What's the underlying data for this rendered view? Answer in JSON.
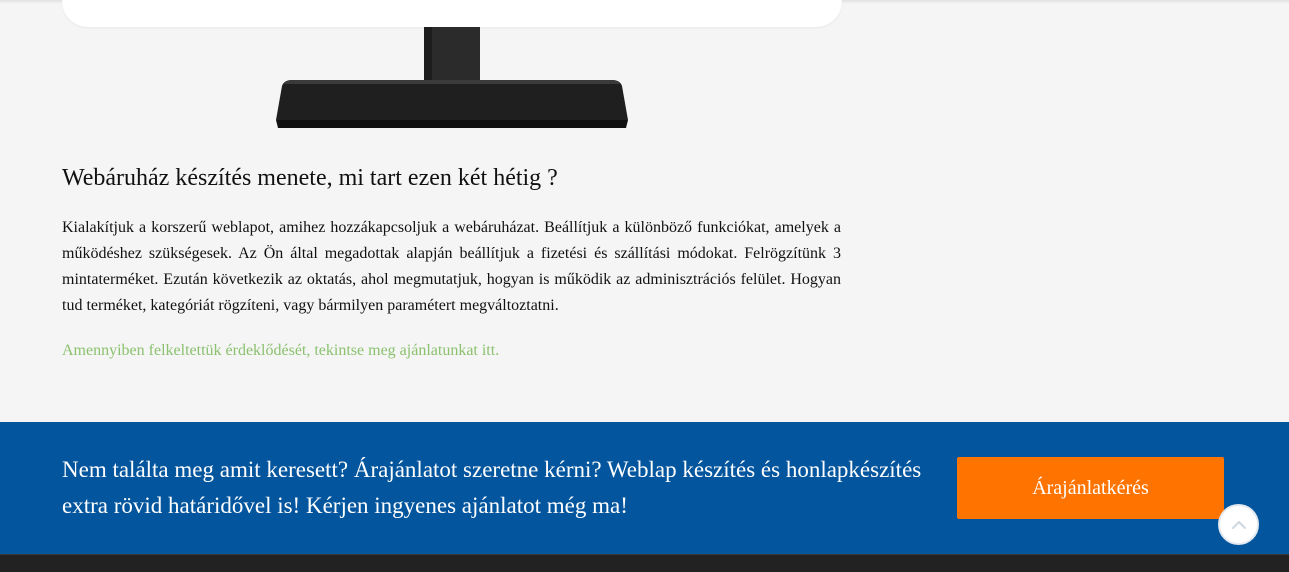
{
  "article": {
    "heading": "Webáruház készítés menete, mi tart ezen két hétig ?",
    "paragraph": "Kialakítjuk a korszerű weblapot, amihez hozzákapcsoljuk a webáruházat. Beállítjuk a különböző funkciókat, amelyek a működéshez szükségesek. Az Ön által megadottak alapján beállítjuk a fizetési és szállítási módokat. Felrögzítünk 3 mintaterméket. Ezután következik az oktatás, ahol megmutatjuk, hogyan is működik az adminisztrációs felület. Hogyan tud terméket, kategóriát rögzíteni, vagy bármilyen paramétert megváltoztatni.",
    "link_text": "Amennyiben felkeltettük érdeklődését, tekintse meg ajánlatunkat itt."
  },
  "cta": {
    "text": "Nem találta meg amit keresett? Árajánlatot szeretne kérni? Weblap készítés és honlapkészítés extra rövid határidővel is! Kérjen ingyenes ajánlatot még ma!",
    "button_label": "Árajánlatkérés"
  },
  "colors": {
    "link": "#8bc16f",
    "cta_background": "#03559d",
    "cta_button": "#ff7300",
    "footer": "#222222"
  },
  "icons": {
    "scroll_top": "chevron-up-icon",
    "monitor": "monitor-illustration"
  }
}
